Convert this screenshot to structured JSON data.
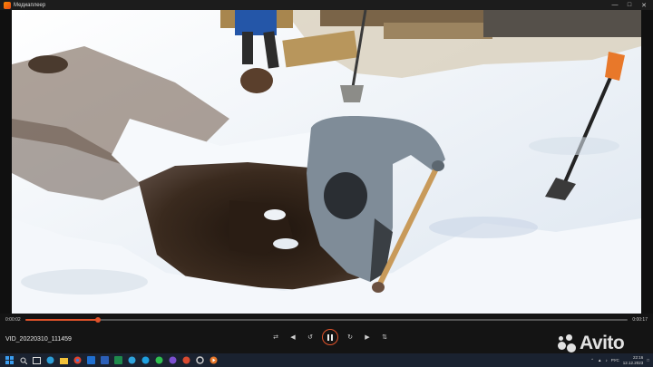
{
  "window": {
    "title": "Медиаплеер"
  },
  "player": {
    "current_time": "0:00:02",
    "total_time": "0:00:17",
    "progress": 0.12,
    "file_name": "VID_20220310_111459",
    "state": "playing"
  },
  "watermark": {
    "brand": "Avito"
  },
  "taskbar": {
    "language": "РУС",
    "time": "22:16",
    "date": "12.12.2023"
  },
  "colors": {
    "accent": "#e0522a",
    "taskbar": "#1a2230"
  }
}
